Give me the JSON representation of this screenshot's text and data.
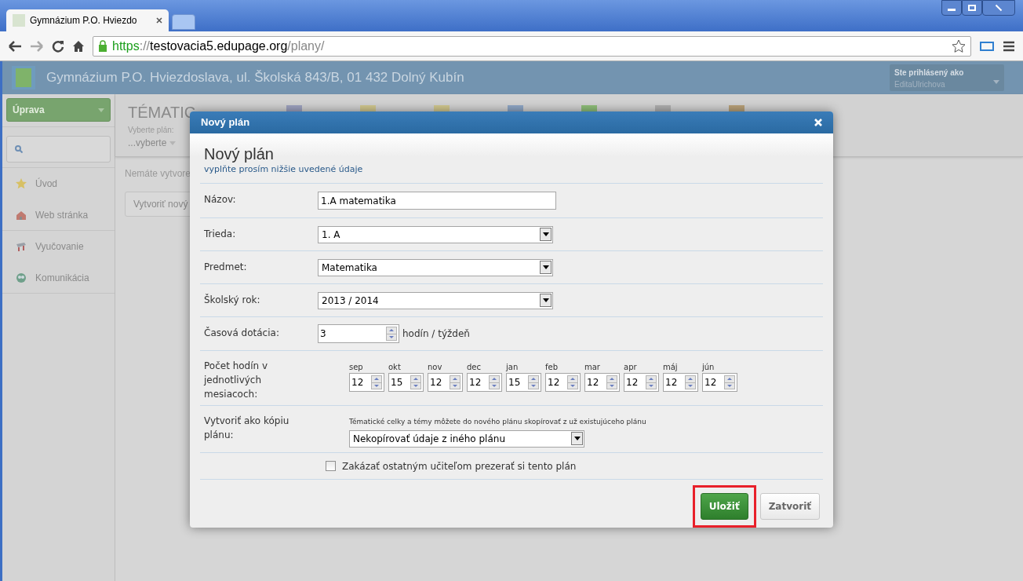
{
  "browser": {
    "tabs": [
      {
        "title": "Gymnázium P.O. Hviezdo",
        "selected": true
      },
      {
        "selected": false
      }
    ],
    "url": {
      "scheme": "https",
      "separator": "://",
      "host": "testovacia5.edupage.org",
      "path": "/plany/"
    }
  },
  "header": {
    "school": "Gymnázium P.O. Hviezdoslava, ul. Školská 843/B, 01 432 Dolný Kubín",
    "login_label": "Ste prihlásený ako",
    "user": "EditaUlrichova"
  },
  "sidebar": {
    "menu_button": "Úprava",
    "items": [
      {
        "label": "Úvod"
      },
      {
        "label": "Web stránka"
      },
      {
        "label": "Vyučovanie"
      },
      {
        "label": "Komunikácia"
      }
    ]
  },
  "main": {
    "title": "TÉMATIC",
    "select_label": "Vyberte plán:",
    "select_value": "...vyberte",
    "message": "Nemáte vytvore",
    "create_button": "Vytvoriť nový"
  },
  "dialog": {
    "title": "Nový plán",
    "heading": "Nový plán",
    "subtitle": "vyplňte prosím nižšie uvedené údaje",
    "fields": [
      {
        "kind": "text",
        "label": "Názov:",
        "value": "1.A matematika"
      },
      {
        "kind": "select",
        "label": "Trieda:",
        "value": "1. A"
      },
      {
        "kind": "select",
        "label": "Predmet:",
        "value": "Matematika"
      },
      {
        "kind": "select",
        "label": "Školský rok:",
        "value": "2013 / 2014"
      },
      {
        "kind": "spinner",
        "label": "Časová dotácia:",
        "value": "3",
        "unit": "hodín / týždeň"
      },
      {
        "kind": "months",
        "label": "Počet hodín v jednotlivých mesiacoch:",
        "months": [
          {
            "name": "sep",
            "value": "12"
          },
          {
            "name": "okt",
            "value": "15"
          },
          {
            "name": "nov",
            "value": "12"
          },
          {
            "name": "dec",
            "value": "12"
          },
          {
            "name": "jan",
            "value": "15"
          },
          {
            "name": "feb",
            "value": "12"
          },
          {
            "name": "mar",
            "value": "12"
          },
          {
            "name": "apr",
            "value": "12"
          },
          {
            "name": "máj",
            "value": "12"
          },
          {
            "name": "jún",
            "value": "12"
          }
        ]
      },
      {
        "kind": "copy",
        "label": "Vytvoriť ako kópiu plánu:",
        "hint": "Tématické celky a témy môžete do nového plánu skopírovať z už existujúceho plánu",
        "value": "Nekopírovať údaje z iného plánu"
      },
      {
        "kind": "checkbox",
        "label": "Zakázať ostatným učiteľom prezerať si tento plán",
        "checked": false
      }
    ],
    "buttons": [
      {
        "label": "Uložiť",
        "kind": "primary",
        "highlighted": true
      },
      {
        "label": "Zatvoriť",
        "kind": "default",
        "highlighted": false
      }
    ]
  }
}
